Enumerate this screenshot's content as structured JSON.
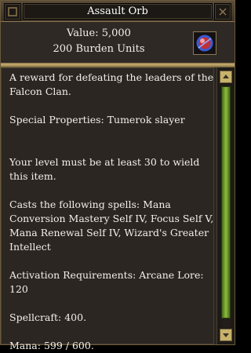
{
  "window": {
    "title": "Assault Orb"
  },
  "header": {
    "value_line": "Value: 5,000",
    "burden_line": "200 Burden Units",
    "icon": "orb-icon"
  },
  "description": {
    "paragraphs": [
      "A reward for defeating the leaders of the Falcon Clan.",
      "Special Properties: Tumerok slayer",
      "Your level must be at least 30 to wield this item.",
      "Casts the following spells: Mana Conversion Mastery Self IV, Focus Self V, Mana Renewal Self IV, Wizard's Greater Intellect",
      "Activation Requirements: Arcane Lore: 120",
      "Spellcraft: 400.",
      "Mana: 599 / 600."
    ]
  },
  "colors": {
    "background": "#2a2521",
    "text": "#f2efe8",
    "accent_gold": "#c9ae6a",
    "scroll_green": "#8fbc3c"
  }
}
